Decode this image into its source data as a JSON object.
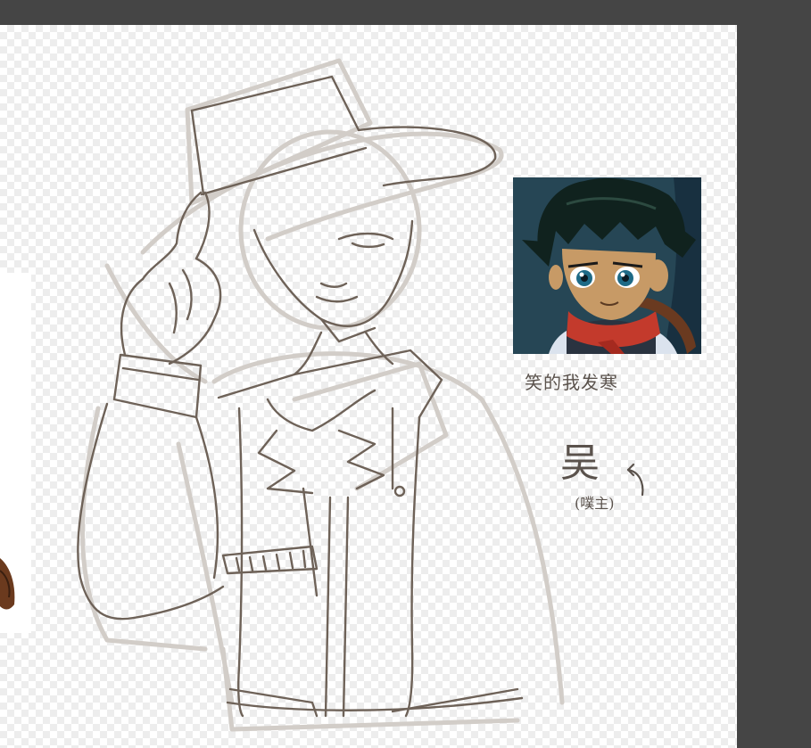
{
  "reference": {
    "caption": "笑的我发寒",
    "note_char": "吴",
    "note_sub": "(噗主)"
  }
}
